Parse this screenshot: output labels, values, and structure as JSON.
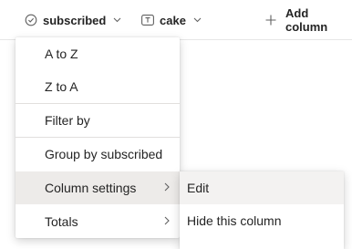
{
  "header": {
    "columns": [
      {
        "label": "subscribed",
        "icon": "checkmark-circle-icon"
      },
      {
        "label": "cake",
        "icon": "text-field-icon"
      }
    ],
    "add_column_label": "Add column"
  },
  "menu": {
    "items": [
      {
        "label": "A to Z"
      },
      {
        "label": "Z to A"
      },
      {
        "label": "Filter by"
      },
      {
        "label": "Group by subscribed"
      },
      {
        "label": "Column settings",
        "has_submenu": true,
        "active": true
      },
      {
        "label": "Totals",
        "has_submenu": true
      }
    ]
  },
  "submenu": {
    "items": [
      {
        "label": "Edit",
        "active": true
      },
      {
        "label": "Hide this column"
      }
    ]
  },
  "colors": {
    "text": "#242424",
    "active_bg": "#edebe9",
    "icon": "#616161"
  }
}
